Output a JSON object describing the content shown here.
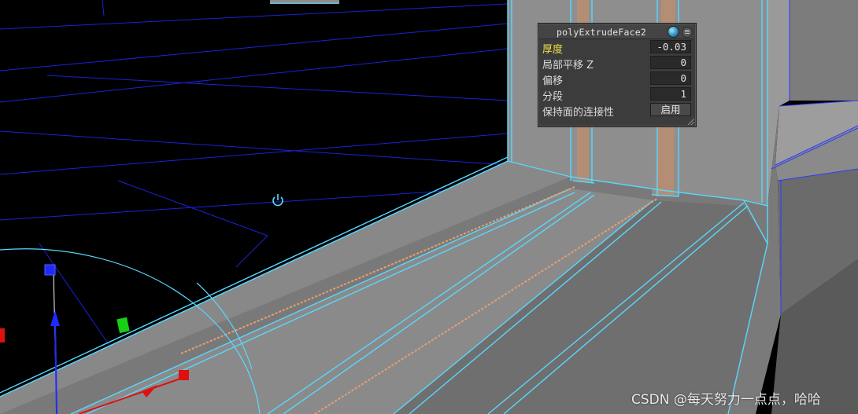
{
  "node_panel": {
    "title": "polyExtrudeFace2",
    "rows": [
      {
        "label": "厚度",
        "value": "-0.03",
        "active": true
      },
      {
        "label": "局部平移 Z",
        "value": "0",
        "active": false
      },
      {
        "label": "偏移",
        "value": "0",
        "active": false
      },
      {
        "label": "分段",
        "value": "1",
        "active": false
      },
      {
        "label": "保持面的连接性",
        "value": "启用",
        "active": false
      }
    ],
    "header_icons": [
      "globe-icon",
      "menu-icon"
    ]
  },
  "viewport": {
    "background": "#000000",
    "grid_color": "#1a22d8",
    "selection_wire_color": "#58d8ff",
    "selected_edge_color": "#e8a070",
    "manipulator": {
      "axis_y_color": "#1d2bff",
      "axis_x_color": "#e01010",
      "axis_z_color": "#15d015",
      "rotate_ring_color": "#5ad8ff"
    },
    "pivot_icon": "power-icon"
  },
  "watermark": "CSDN @每天努力一点点，哈哈"
}
